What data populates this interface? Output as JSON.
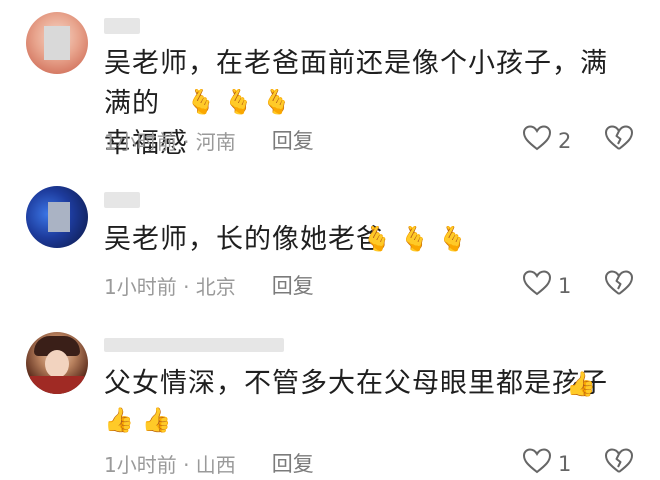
{
  "comments": [
    {
      "line1": "吴老师，在老爸面前还是像个小孩子，满满的",
      "line2": "幸福感",
      "emoji": [
        "🫰",
        "🫰",
        "🫰"
      ],
      "time": "1小时前 · 河南",
      "reply": "回复",
      "likes": "2"
    },
    {
      "line1": "吴老师，长的像她老爸",
      "emoji": [
        "🫰",
        "🫰",
        "🫰"
      ],
      "time": "1小时前 · 北京",
      "reply": "回复",
      "likes": "1"
    },
    {
      "line1": "父女情深，不管多大在父母眼里都是孩子",
      "emoji_inline": [
        "👍"
      ],
      "emoji_line2": [
        "👍",
        "👍"
      ],
      "time": "1小时前 · 山西",
      "reply": "回复",
      "likes": "1"
    }
  ],
  "icons": {
    "like": "heart-outline-icon",
    "dislike": "broken-heart-icon"
  },
  "colors": {
    "meta": "#9a9a9a",
    "text": "#1f1f1f",
    "icon": "#666666"
  }
}
